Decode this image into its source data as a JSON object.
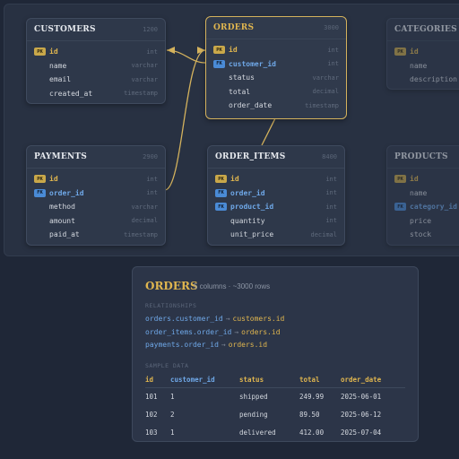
{
  "tables": {
    "customers": {
      "name": "CUSTOMERS",
      "meta": "1200",
      "columns": [
        {
          "key": "PK",
          "name": "id",
          "type": "int"
        },
        {
          "key": "",
          "name": "name",
          "type": "varchar"
        },
        {
          "key": "",
          "name": "email",
          "type": "varchar"
        },
        {
          "key": "",
          "name": "created_at",
          "type": "timestamp"
        }
      ]
    },
    "orders": {
      "name": "ORDERS",
      "meta": "3000",
      "columns": [
        {
          "key": "PK",
          "name": "id",
          "type": "int"
        },
        {
          "key": "FK",
          "name": "customer_id",
          "type": "int"
        },
        {
          "key": "",
          "name": "status",
          "type": "varchar"
        },
        {
          "key": "",
          "name": "total",
          "type": "decimal"
        },
        {
          "key": "",
          "name": "order_date",
          "type": "timestamp"
        }
      ]
    },
    "categories": {
      "name": "CATEGORIES",
      "meta": "",
      "columns": [
        {
          "key": "PK",
          "name": "id",
          "type": ""
        },
        {
          "key": "",
          "name": "name",
          "type": ""
        },
        {
          "key": "",
          "name": "description",
          "type": ""
        }
      ]
    },
    "payments": {
      "name": "PAYMENTS",
      "meta": "2900",
      "columns": [
        {
          "key": "PK",
          "name": "id",
          "type": "int"
        },
        {
          "key": "FK",
          "name": "order_id",
          "type": "int"
        },
        {
          "key": "",
          "name": "method",
          "type": "varchar"
        },
        {
          "key": "",
          "name": "amount",
          "type": "decimal"
        },
        {
          "key": "",
          "name": "paid_at",
          "type": "timestamp"
        }
      ]
    },
    "order_items": {
      "name": "ORDER_ITEMS",
      "meta": "8400",
      "columns": [
        {
          "key": "PK",
          "name": "id",
          "type": "int"
        },
        {
          "key": "FK",
          "name": "order_id",
          "type": "int"
        },
        {
          "key": "FK",
          "name": "product_id",
          "type": "int"
        },
        {
          "key": "",
          "name": "quantity",
          "type": "int"
        },
        {
          "key": "",
          "name": "unit_price",
          "type": "decimal"
        }
      ]
    },
    "products": {
      "name": "PRODUCTS",
      "meta": "",
      "columns": [
        {
          "key": "PK",
          "name": "id",
          "type": ""
        },
        {
          "key": "",
          "name": "name",
          "type": ""
        },
        {
          "key": "FK",
          "name": "category_id",
          "type": ""
        },
        {
          "key": "",
          "name": "price",
          "type": ""
        },
        {
          "key": "",
          "name": "stock",
          "type": ""
        }
      ]
    }
  },
  "detail": {
    "title": "ORDERS",
    "meta": "5 columns · ~3000 rows",
    "relationships_label": "RELATIONSHIPS",
    "relationships": [
      {
        "from": "orders.customer_id",
        "arrow": "→",
        "to": "customers.id"
      },
      {
        "from": "order_items.order_id",
        "arrow": "→",
        "to": "orders.id"
      },
      {
        "from": "payments.order_id",
        "arrow": "→",
        "to": "orders.id"
      }
    ],
    "sample_label": "SAMPLE DATA",
    "sample_headers": [
      "id",
      "customer_id",
      "status",
      "total",
      "order_date"
    ],
    "sample_rows": [
      [
        "101",
        "1",
        "shipped",
        "249.99",
        "2025-06-01"
      ],
      [
        "102",
        "2",
        "pending",
        "89.50",
        "2025-06-12"
      ],
      [
        "103",
        "1",
        "delivered",
        "412.00",
        "2025-07-04"
      ]
    ]
  },
  "colors": {
    "accent": "#e0b64f",
    "foreign_key": "#6fa8e8",
    "background": "#1f2737"
  }
}
